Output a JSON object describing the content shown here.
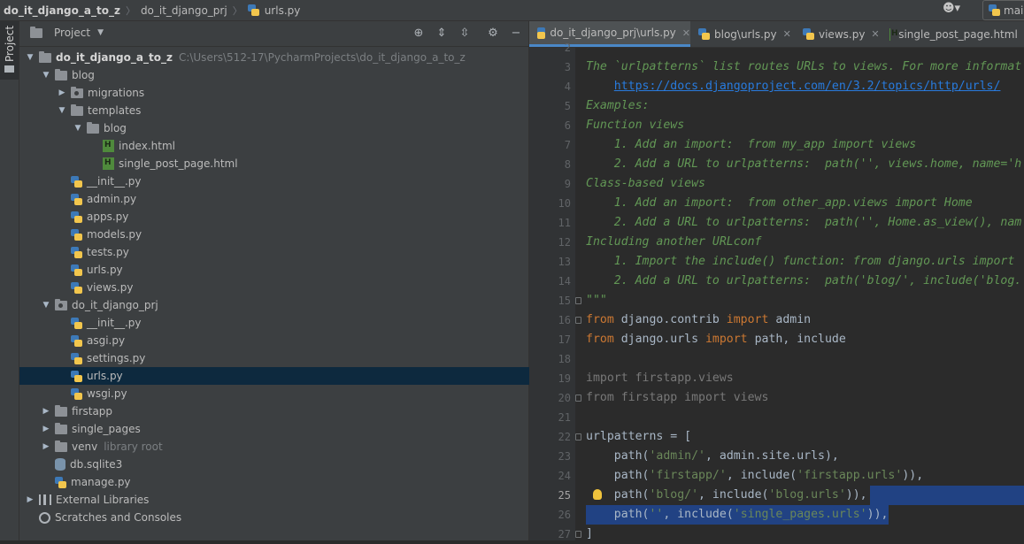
{
  "breadcrumbs": [
    "do_it_django_a_to_z",
    "do_it_django_prj",
    "urls.py"
  ],
  "top_right": {
    "run_config_label": "mai"
  },
  "sidebar_strip": {
    "label": "Project"
  },
  "project_panel": {
    "title": "Project",
    "tree": [
      {
        "depth": 0,
        "arrow": "down",
        "icon": "folder",
        "label": "do_it_django_a_to_z",
        "bold": true,
        "hint": "C:\\Users\\512-17\\PycharmProjects\\do_it_django_a_to_z"
      },
      {
        "depth": 1,
        "arrow": "down",
        "icon": "folder",
        "label": "blog"
      },
      {
        "depth": 2,
        "arrow": "right",
        "icon": "package",
        "label": "migrations"
      },
      {
        "depth": 2,
        "arrow": "down",
        "icon": "folder",
        "label": "templates"
      },
      {
        "depth": 3,
        "arrow": "down",
        "icon": "folder",
        "label": "blog"
      },
      {
        "depth": 4,
        "arrow": "none",
        "icon": "html",
        "label": "index.html"
      },
      {
        "depth": 4,
        "arrow": "none",
        "icon": "html",
        "label": "single_post_page.html"
      },
      {
        "depth": 2,
        "arrow": "none",
        "icon": "python",
        "label": "__init__.py"
      },
      {
        "depth": 2,
        "arrow": "none",
        "icon": "python",
        "label": "admin.py"
      },
      {
        "depth": 2,
        "arrow": "none",
        "icon": "python",
        "label": "apps.py"
      },
      {
        "depth": 2,
        "arrow": "none",
        "icon": "python",
        "label": "models.py"
      },
      {
        "depth": 2,
        "arrow": "none",
        "icon": "python",
        "label": "tests.py"
      },
      {
        "depth": 2,
        "arrow": "none",
        "icon": "python",
        "label": "urls.py"
      },
      {
        "depth": 2,
        "arrow": "none",
        "icon": "python",
        "label": "views.py"
      },
      {
        "depth": 1,
        "arrow": "down",
        "icon": "package",
        "label": "do_it_django_prj"
      },
      {
        "depth": 2,
        "arrow": "none",
        "icon": "python",
        "label": "__init__.py"
      },
      {
        "depth": 2,
        "arrow": "none",
        "icon": "python",
        "label": "asgi.py"
      },
      {
        "depth": 2,
        "arrow": "none",
        "icon": "python",
        "label": "settings.py"
      },
      {
        "depth": 2,
        "arrow": "none",
        "icon": "python",
        "label": "urls.py",
        "selected": true
      },
      {
        "depth": 2,
        "arrow": "none",
        "icon": "python",
        "label": "wsgi.py"
      },
      {
        "depth": 1,
        "arrow": "right",
        "icon": "folder",
        "label": "firstapp"
      },
      {
        "depth": 1,
        "arrow": "right",
        "icon": "folder",
        "label": "single_pages"
      },
      {
        "depth": 1,
        "arrow": "right",
        "icon": "folder",
        "label": "venv",
        "hint": "library root"
      },
      {
        "depth": 1,
        "arrow": "none",
        "icon": "db",
        "label": "db.sqlite3"
      },
      {
        "depth": 1,
        "arrow": "none",
        "icon": "python",
        "label": "manage.py"
      },
      {
        "depth": 0,
        "arrow": "right",
        "icon": "library",
        "label": "External Libraries"
      },
      {
        "depth": 0,
        "arrow": "none",
        "icon": "scratches",
        "label": "Scratches and Consoles"
      }
    ]
  },
  "editor": {
    "tabs": [
      {
        "label": "do_it_django_prj\\urls.py",
        "active": true
      },
      {
        "label": "blog\\urls.py"
      },
      {
        "label": "views.py"
      },
      {
        "label": "single_post_page.html"
      }
    ],
    "current_line": 25,
    "lines": [
      {
        "n": "2",
        "tokens": []
      },
      {
        "n": "3",
        "tokens": [
          {
            "t": "The `urlpatterns` list routes URLs to views. For more informat",
            "c": "doc"
          }
        ]
      },
      {
        "n": "4",
        "tokens": [
          {
            "t": "    ",
            "c": "doc"
          },
          {
            "t": "https://docs.djangoproject.com/en/3.2/topics/http/urls/",
            "c": "url"
          }
        ]
      },
      {
        "n": "5",
        "tokens": [
          {
            "t": "Examples:",
            "c": "doc"
          }
        ]
      },
      {
        "n": "6",
        "tokens": [
          {
            "t": "Function views",
            "c": "doc"
          }
        ]
      },
      {
        "n": "7",
        "tokens": [
          {
            "t": "    1. Add an import:  from my_app import views",
            "c": "doc"
          }
        ]
      },
      {
        "n": "8",
        "tokens": [
          {
            "t": "    2. Add a URL to urlpatterns:  path('', views.home, name='h",
            "c": "doc"
          }
        ]
      },
      {
        "n": "9",
        "tokens": [
          {
            "t": "Class-based views",
            "c": "doc"
          }
        ]
      },
      {
        "n": "10",
        "tokens": [
          {
            "t": "    1. Add an import:  from other_app.views import Home",
            "c": "doc"
          }
        ]
      },
      {
        "n": "11",
        "tokens": [
          {
            "t": "    2. Add a URL to urlpatterns:  path('', Home.as_view(), nam",
            "c": "doc"
          }
        ]
      },
      {
        "n": "12",
        "tokens": [
          {
            "t": "Including another URLconf",
            "c": "doc"
          }
        ]
      },
      {
        "n": "13",
        "tokens": [
          {
            "t": "    1. Import the include() function: from django.urls import ",
            "c": "doc"
          }
        ]
      },
      {
        "n": "14",
        "tokens": [
          {
            "t": "    2. Add a URL to urlpatterns:  path('blog/', include('blog.",
            "c": "doc"
          }
        ]
      },
      {
        "n": "15",
        "tokens": [
          {
            "t": "\"\"\"",
            "c": "doc"
          }
        ],
        "fold": true
      },
      {
        "n": "16",
        "tokens": [
          {
            "t": "from ",
            "c": "kw"
          },
          {
            "t": "django.contrib ",
            "c": "plain"
          },
          {
            "t": "import ",
            "c": "kw"
          },
          {
            "t": "admin",
            "c": "plain"
          }
        ],
        "fold": true
      },
      {
        "n": "17",
        "tokens": [
          {
            "t": "from ",
            "c": "kw"
          },
          {
            "t": "django.urls ",
            "c": "plain"
          },
          {
            "t": "import ",
            "c": "kw"
          },
          {
            "t": "path, include",
            "c": "plain"
          }
        ]
      },
      {
        "n": "18",
        "tokens": []
      },
      {
        "n": "19",
        "tokens": [
          {
            "t": "import firstapp.views",
            "c": "dim"
          }
        ]
      },
      {
        "n": "20",
        "tokens": [
          {
            "t": "from firstapp import views",
            "c": "dim"
          }
        ],
        "fold": true
      },
      {
        "n": "21",
        "tokens": []
      },
      {
        "n": "22",
        "tokens": [
          {
            "t": "urlpatterns = [",
            "c": "plain"
          }
        ],
        "fold": true
      },
      {
        "n": "23",
        "tokens": [
          {
            "t": "    path(",
            "c": "plain"
          },
          {
            "t": "'admin/'",
            "c": "str"
          },
          {
            "t": ", admin.site.urls),",
            "c": "plain"
          }
        ]
      },
      {
        "n": "24",
        "tokens": [
          {
            "t": "    path(",
            "c": "plain"
          },
          {
            "t": "'firstapp/'",
            "c": "str"
          },
          {
            "t": ", include(",
            "c": "plain"
          },
          {
            "t": "'firstapp.urls'",
            "c": "str"
          },
          {
            "t": ")),",
            "c": "plain"
          }
        ]
      },
      {
        "n": "25",
        "tokens": [
          {
            "t": "    path(",
            "c": "plain"
          },
          {
            "t": "'blog/'",
            "c": "str"
          },
          {
            "t": ", include(",
            "c": "plain"
          },
          {
            "t": "'blog.urls'",
            "c": "str"
          },
          {
            "t": ")),",
            "c": "plain"
          }
        ],
        "bulb": true,
        "highlight": "right"
      },
      {
        "n": "26",
        "tokens": [
          {
            "t": "    path(",
            "c": "plain"
          },
          {
            "t": "''",
            "c": "str"
          },
          {
            "t": ", include(",
            "c": "plain"
          },
          {
            "t": "'single_pages.urls'",
            "c": "str"
          },
          {
            "t": ")),",
            "c": "plain"
          }
        ],
        "highlight": "full"
      },
      {
        "n": "27",
        "tokens": [
          {
            "t": "]",
            "c": "plain"
          }
        ],
        "fold": true
      }
    ]
  }
}
